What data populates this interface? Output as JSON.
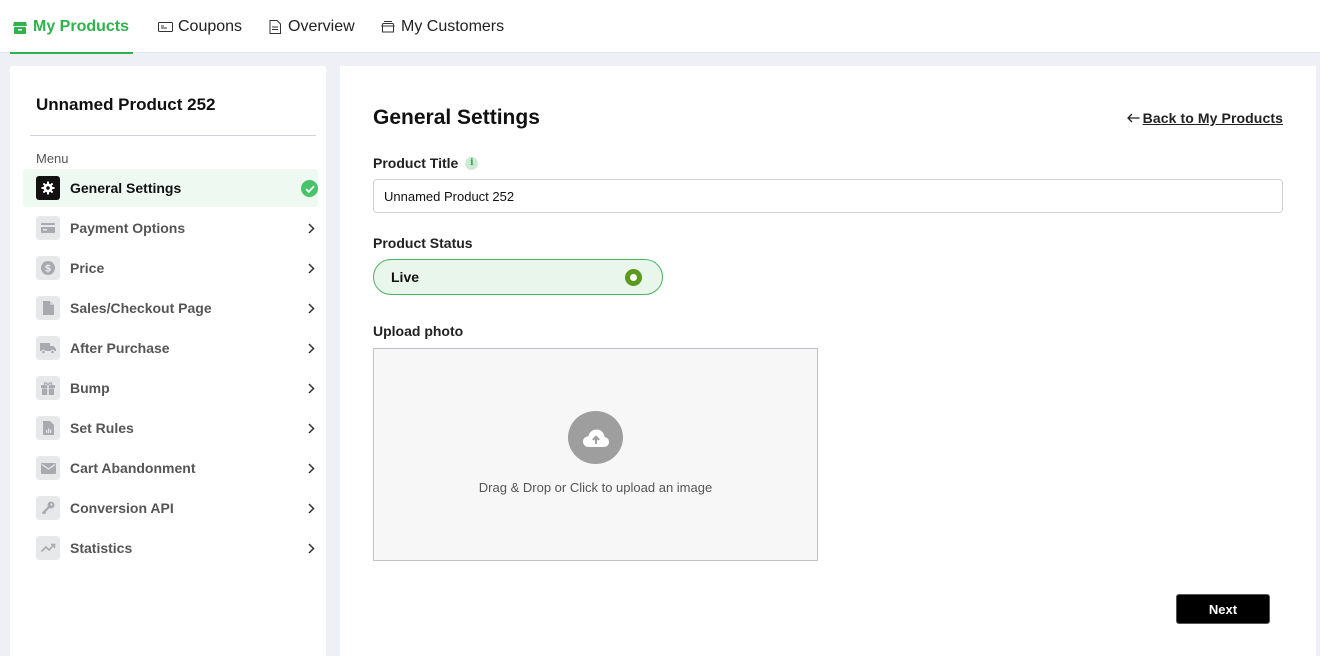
{
  "nav": {
    "tabs": [
      {
        "label": "My Products",
        "icon": "store-icon",
        "active": true
      },
      {
        "label": "Coupons",
        "icon": "ticket-icon",
        "active": false
      },
      {
        "label": "Overview",
        "icon": "document-icon",
        "active": false
      },
      {
        "label": "My Customers",
        "icon": "customers-icon",
        "active": false
      }
    ]
  },
  "sidebar": {
    "product_name": "Unnamed Product 252",
    "menu_label": "Menu",
    "items": [
      {
        "label": "General Settings",
        "icon": "gear-icon",
        "active": true,
        "completed": true
      },
      {
        "label": "Payment Options",
        "icon": "credit-card-icon"
      },
      {
        "label": "Price",
        "icon": "dollar-icon"
      },
      {
        "label": "Sales/Checkout Page",
        "icon": "page-icon"
      },
      {
        "label": "After Purchase",
        "icon": "truck-icon"
      },
      {
        "label": "Bump",
        "icon": "gift-icon"
      },
      {
        "label": "Set Rules",
        "icon": "report-icon"
      },
      {
        "label": "Cart Abandonment",
        "icon": "mail-icon"
      },
      {
        "label": "Conversion API",
        "icon": "key-icon"
      },
      {
        "label": "Statistics",
        "icon": "trending-icon"
      }
    ]
  },
  "main": {
    "title": "General Settings",
    "back_link": "Back to My Products",
    "product_title_label": "Product Title",
    "product_title_value": "Unnamed Product 252",
    "product_status_label": "Product Status",
    "status_value": "Live",
    "upload_label": "Upload photo",
    "upload_text": "Drag & Drop or Click to upload an image",
    "next_label": "Next"
  },
  "colors": {
    "accent": "#2fb24c",
    "status_bg": "#e8f6eb",
    "status_radio": "#5a9a1e"
  }
}
